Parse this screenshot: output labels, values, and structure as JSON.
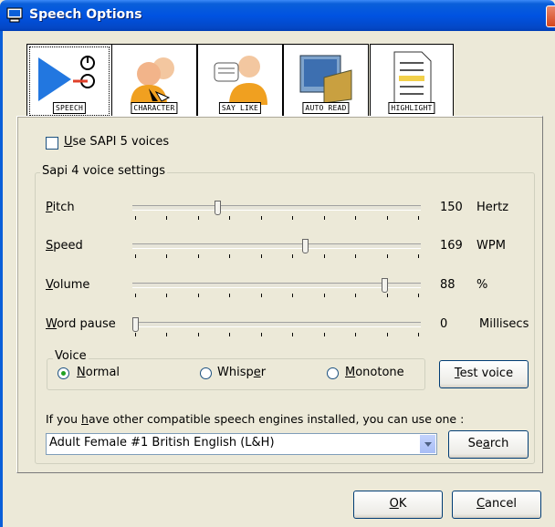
{
  "window": {
    "title": "Speech Options"
  },
  "tabs": [
    {
      "label": "SPEECH",
      "icon": "speech-play-icon"
    },
    {
      "label": "CHARACTER",
      "icon": "character-people-icon"
    },
    {
      "label": "SAY LIKE",
      "icon": "say-like-people-icon"
    },
    {
      "label": "AUTO READ",
      "icon": "auto-read-book-icon"
    },
    {
      "label": "HIGHLIGHT",
      "icon": "highlight-document-icon"
    }
  ],
  "use_sapi5": {
    "label_prefix": "U",
    "label_rest": "se SAPI 5 voices",
    "checked": false
  },
  "sapi4": {
    "group_title": "Sapi 4 voice settings",
    "sliders": [
      {
        "label_first": "P",
        "label_rest": "itch",
        "value": "150",
        "unit": "Hertz",
        "fraction": 0.29
      },
      {
        "label_first": "S",
        "label_rest": "peed",
        "value": "169",
        "unit": "WPM",
        "fraction": 0.6
      },
      {
        "label_first": "V",
        "label_rest": "olume",
        "value": "88",
        "unit": "%",
        "fraction": 0.88
      },
      {
        "label_first": "W",
        "label_rest": "ord pause",
        "value": "0",
        "unit": "Millisecs",
        "fraction": 0.0
      }
    ],
    "voice": {
      "group_title": "Voice",
      "options": [
        {
          "prefix": "",
          "underline": "N",
          "suffix": "ormal",
          "selected": true
        },
        {
          "prefix": "Whisp",
          "underline": "e",
          "suffix": "r",
          "selected": false
        },
        {
          "prefix": "",
          "underline": "M",
          "suffix": "onotone",
          "selected": false
        }
      ],
      "test_button": {
        "underline": "T",
        "rest": "est voice"
      }
    }
  },
  "engines": {
    "prompt_prefix": "If you ",
    "prompt_underline": "h",
    "prompt_rest": "ave other compatible speech engines installed, you can use one :",
    "selected": "Adult Female #1 British English (L&H)",
    "search_button": {
      "prefix": "Se",
      "underline": "a",
      "rest": "rch"
    }
  },
  "footer": {
    "ok": {
      "underline": "O",
      "rest": "K"
    },
    "cancel": {
      "underline": "C",
      "rest": "ancel"
    }
  }
}
